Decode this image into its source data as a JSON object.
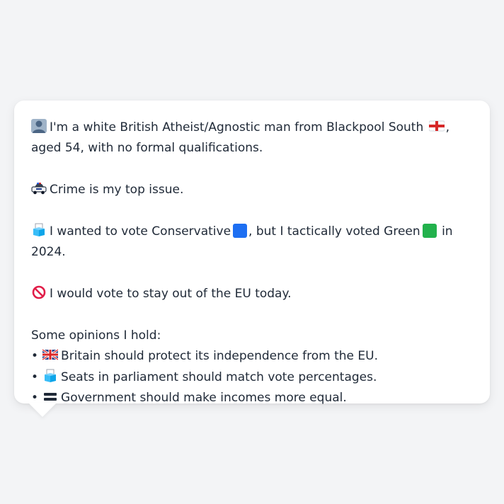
{
  "persona": {
    "intro": "I'm a white British Atheist/Agnostic man from Blackpool South",
    "intro_cont": ", aged 54, with no formal qualifications.",
    "crime": "Crime is my top issue.",
    "vote_a": "I wanted to vote Conservative",
    "vote_b": ", but I tactically voted Green",
    "vote_c": "in 2024.",
    "eu": "I would vote to stay out of the EU today.",
    "opinions_heading": "Some opinions I hold:",
    "opinions": [
      "Britain should protect its independence from the EU.",
      "Seats in parliament should match vote percentages.",
      "Government should make incomes more equal."
    ],
    "bullet": "•"
  },
  "icons": {
    "person": "bust-in-silhouette-icon",
    "england_flag": "england-flag-icon",
    "police_car": "police-car-icon",
    "ballot_box": "ballot-box-icon",
    "no_entry": "prohibited-icon",
    "uk_flag": "uk-flag-icon",
    "equals": "heavy-equals-icon"
  },
  "colors": {
    "background": "#f3f4f6",
    "bubble": "#ffffff",
    "text": "#1f2937",
    "conservative_blue": "#1d6ff2",
    "green_party": "#22b14c"
  }
}
